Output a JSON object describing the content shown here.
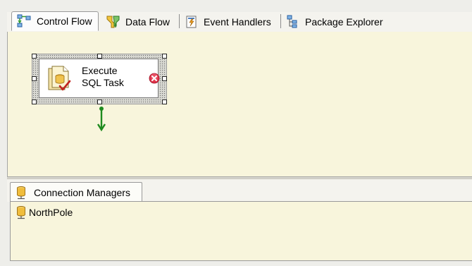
{
  "designer_tabs": [
    {
      "label": "Control Flow",
      "icon": "control-flow-icon",
      "active": true
    },
    {
      "label": "Data Flow",
      "icon": "data-flow-icon",
      "active": false
    },
    {
      "label": "Event Handlers",
      "icon": "event-handlers-icon",
      "active": false
    },
    {
      "label": "Package Explorer",
      "icon": "package-explorer-icon",
      "active": false
    }
  ],
  "canvas": {
    "background": "#f8f5dc",
    "task": {
      "line1": "Execute",
      "line2": "SQL Task",
      "icon": "execute-sql-task-icon",
      "status_icon": "error-icon",
      "status_color": "#e0334a",
      "selected": true
    },
    "precedence_arrow_color": "#1e8a1e"
  },
  "connection_managers": {
    "tab_label": "Connection Managers",
    "tab_icon": "connection-manager-icon",
    "items": [
      {
        "label": "NorthPole",
        "icon": "connection-manager-icon"
      }
    ]
  }
}
